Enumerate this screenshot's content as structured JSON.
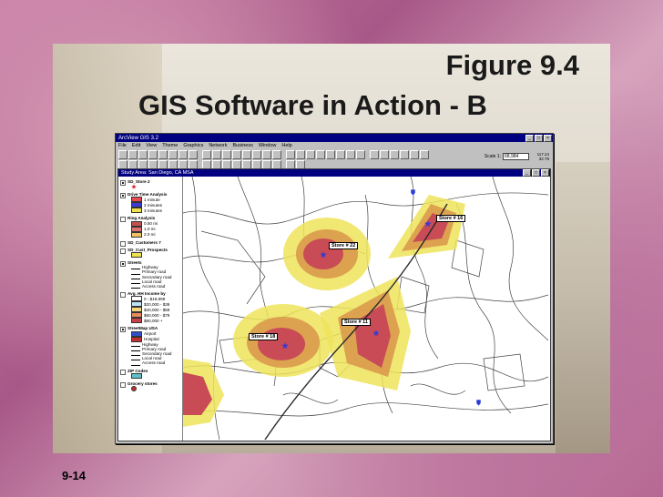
{
  "slide": {
    "title_line1": "Figure 9.4",
    "title_line2": "GIS Software in Action - B",
    "slide_number": "9-14"
  },
  "app": {
    "title": "ArcView GIS 3.2",
    "window_buttons": [
      "_",
      "□",
      "×"
    ],
    "menu": [
      "File",
      "Edit",
      "View",
      "Theme",
      "Graphics",
      "Network",
      "Business",
      "Window",
      "Help"
    ],
    "scale_label": "Scale 1:",
    "scale_value": "68,984",
    "coords": [
      "117.24",
      "32.79"
    ],
    "view_title": "Study Area: San Diego, CA MSA"
  },
  "toc": [
    {
      "name": "SD_Store 2",
      "checked": true,
      "items": [
        {
          "label": "",
          "kind": "star"
        }
      ]
    },
    {
      "name": "Drive Time Analysis",
      "checked": true,
      "items": [
        {
          "label": "1 minute",
          "kind": "fill",
          "color": "#e64a54"
        },
        {
          "label": "2 minutes",
          "kind": "fill",
          "color": "#3b3bd1"
        },
        {
          "label": "3 minutes",
          "kind": "fill",
          "color": "#f0e04c"
        }
      ]
    },
    {
      "name": "Ring Analysis",
      "checked": false,
      "items": [
        {
          "label": "0.50 mi",
          "kind": "fill",
          "color": "#c35050"
        },
        {
          "label": "1.0 mi",
          "kind": "fill",
          "color": "#e07070"
        },
        {
          "label": "2.0 mi",
          "kind": "fill",
          "color": "#f2c060"
        }
      ]
    },
    {
      "name": "SD_Customers 7",
      "checked": false,
      "items": []
    },
    {
      "name": "SD_Cust_Prospects",
      "checked": false,
      "items": [
        {
          "label": "",
          "kind": "fill",
          "color": "#f0e04c"
        }
      ]
    },
    {
      "name": "Streets",
      "checked": true,
      "items": [
        {
          "label": "Highway",
          "kind": "line"
        },
        {
          "label": "Primary road",
          "kind": "line"
        },
        {
          "label": "Secondary road",
          "kind": "line"
        },
        {
          "label": "Local road",
          "kind": "line"
        },
        {
          "label": "Access road",
          "kind": "line"
        }
      ]
    },
    {
      "name": "Avg. HH Income by",
      "checked": false,
      "items": [
        {
          "label": "0 - $19,999",
          "kind": "fill",
          "color": "#ffffff"
        },
        {
          "label": "$20,000 - $39",
          "kind": "fill",
          "color": "#bfe3f7"
        },
        {
          "label": "$40,000 - $59",
          "kind": "fill",
          "color": "#f5d77c"
        },
        {
          "label": "$60,000 - $79",
          "kind": "fill",
          "color": "#e98a5f"
        },
        {
          "label": "$80,000 +",
          "kind": "fill",
          "color": "#c8414a"
        }
      ]
    },
    {
      "name": "StreetMap USA",
      "checked": true,
      "items": [
        {
          "label": "Airport",
          "kind": "fill",
          "color": "#3050c8"
        },
        {
          "label": "Hospital",
          "kind": "fill",
          "color": "#c03030"
        },
        {
          "label": "Highway",
          "kind": "line"
        },
        {
          "label": "Primary road",
          "kind": "line"
        },
        {
          "label": "Secondary road",
          "kind": "line"
        },
        {
          "label": "Local road",
          "kind": "line"
        },
        {
          "label": "Access road",
          "kind": "line"
        }
      ]
    },
    {
      "name": "ZIP Codes",
      "checked": false,
      "items": [
        {
          "label": "",
          "kind": "fill",
          "color": "#5bc3c8"
        }
      ]
    },
    {
      "name": "Grocery stores",
      "checked": false,
      "items": [
        {
          "label": "",
          "kind": "dot",
          "color": "#c03030"
        }
      ]
    }
  ],
  "map": {
    "stores": [
      {
        "label": "Store # 16",
        "id": "store-16"
      },
      {
        "label": "Store # 22",
        "id": "store-22"
      },
      {
        "label": "Store # 11",
        "id": "store-11"
      },
      {
        "label": "Store # 18",
        "id": "store-18"
      }
    ],
    "colors": {
      "ring_outer": "#efe35a",
      "ring_mid": "#d99a4b",
      "ring_inner": "#c94b56",
      "streets": "#222222",
      "store": "#2f3bd4"
    }
  }
}
